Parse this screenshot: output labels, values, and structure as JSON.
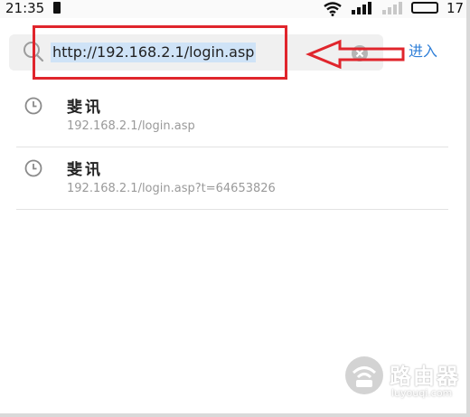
{
  "status_bar": {
    "time": "21:35",
    "battery": "17",
    "icons": [
      "sim-card-icon",
      "wifi-icon",
      "signal-icon",
      "signal-icon",
      "battery-icon"
    ]
  },
  "address_bar": {
    "url": "http://192.168.2.1/login.asp",
    "enter_label": "进入",
    "icons": [
      "search-icon",
      "clear-icon"
    ]
  },
  "history": {
    "items": [
      {
        "title": "斐讯",
        "url": "192.168.2.1/login.asp",
        "icon": "clock-icon"
      },
      {
        "title": "斐讯",
        "url": "192.168.2.1/login.asp?t=64653826",
        "icon": "clock-icon"
      }
    ]
  },
  "watermark": {
    "name": "路由器",
    "domain": "luyouqi.com"
  },
  "colors": {
    "annotation": "#e0252c",
    "link": "#2f7fd8",
    "selection": "#cfe3f7"
  }
}
